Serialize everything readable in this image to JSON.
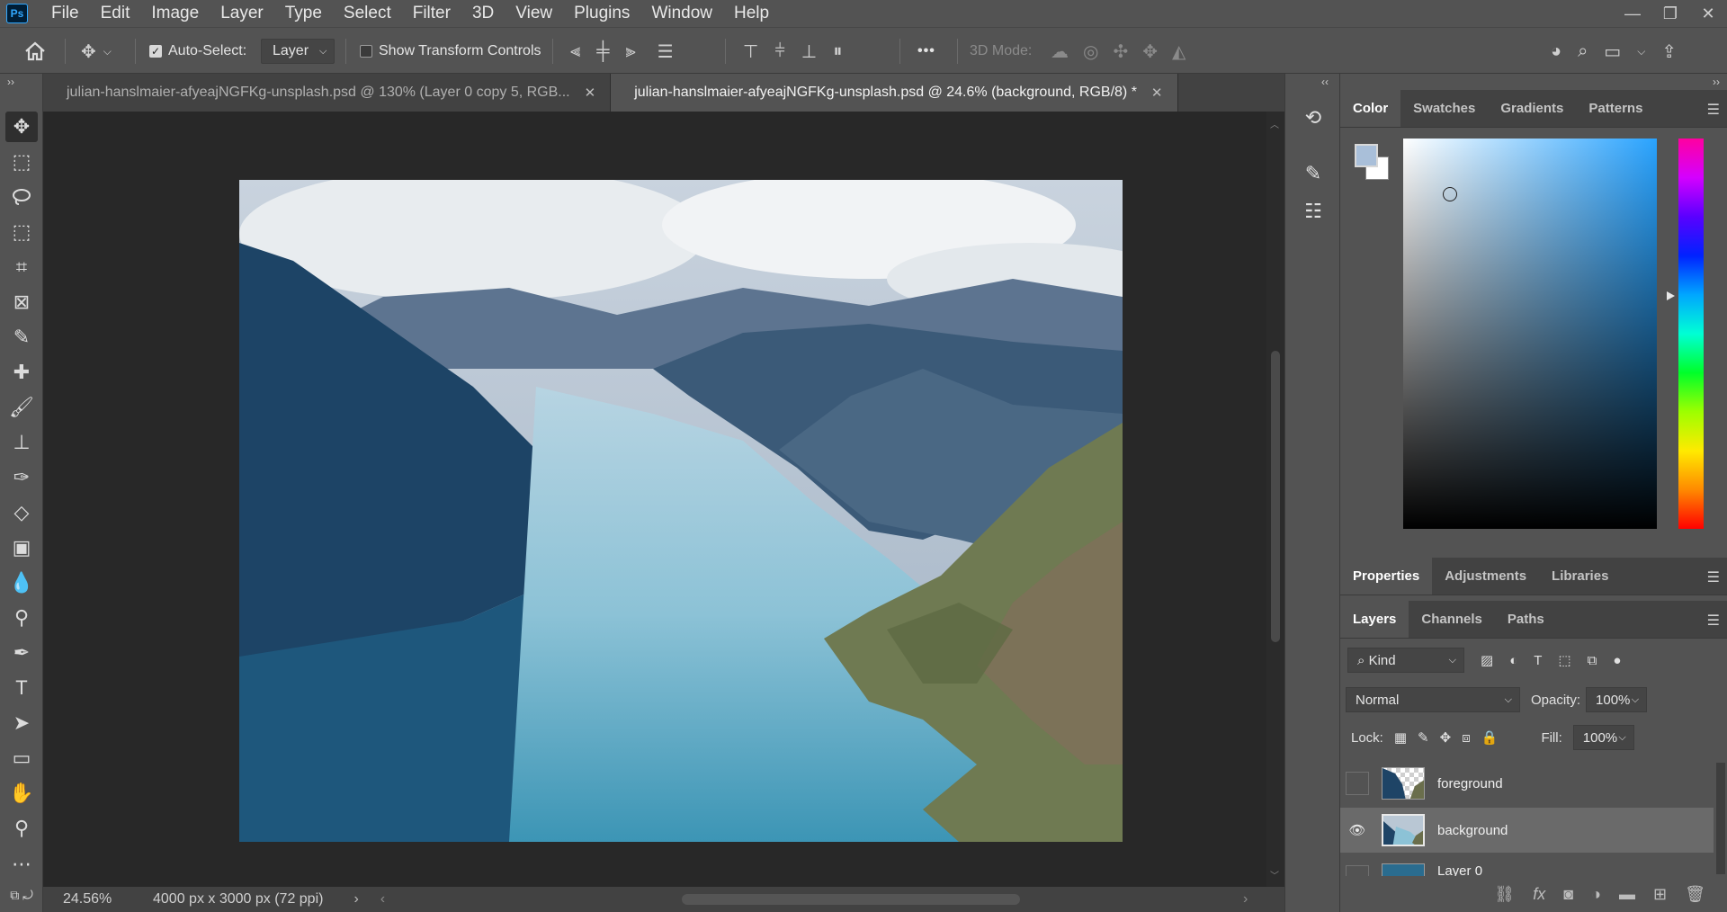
{
  "app": {
    "logo": "Ps"
  },
  "menu": [
    "File",
    "Edit",
    "Image",
    "Layer",
    "Type",
    "Select",
    "Filter",
    "3D",
    "View",
    "Plugins",
    "Window",
    "Help"
  ],
  "window_controls": {
    "minimize": "—",
    "restore": "❐",
    "close": "✕"
  },
  "options": {
    "auto_select_label": "Auto-Select:",
    "auto_select_checked": true,
    "auto_select_target": "Layer",
    "show_transform_label": "Show Transform Controls",
    "show_transform_checked": false,
    "more": "•••",
    "mode_3d_label": "3D Mode:"
  },
  "tabs": [
    {
      "title": "julian-hanslmaier-afyeajNGFKg-unsplash.psd @ 130% (Layer 0 copy 5, RGB...",
      "close": "✕"
    },
    {
      "title": "julian-hanslmaier-afyeajNGFKg-unsplash.psd @ 24.6% (background, RGB/8) *",
      "close": "✕"
    }
  ],
  "status": {
    "zoom": "24.56%",
    "doc_info": "4000 px x 3000 px (72 ppi)",
    "arrow": "›",
    "left_arrow": "‹",
    "right_arrow": "›"
  },
  "panels": {
    "collapse_left": "‹‹",
    "collapse_right": "››",
    "color_tabs": [
      "Color",
      "Swatches",
      "Gradients",
      "Patterns"
    ],
    "colors": {
      "foreground": "#a9bfd9",
      "background": "#ffffff",
      "picker_hue": "#29a3ff"
    },
    "props_tabs": [
      "Properties",
      "Adjustments",
      "Libraries"
    ],
    "layers_tabs": [
      "Layers",
      "Channels",
      "Paths"
    ],
    "kind_label": "Kind",
    "blend_mode": "Normal",
    "opacity_label": "Opacity:",
    "opacity_value": "100%",
    "lock_label": "Lock:",
    "fill_label": "Fill:",
    "fill_value": "100%"
  },
  "layers": [
    {
      "name": "foreground",
      "visible": false,
      "selected": false
    },
    {
      "name": "background",
      "visible": true,
      "selected": true
    },
    {
      "name": "Layer 0",
      "visible": false,
      "selected": false
    }
  ],
  "layer_footer_icons": [
    "link-icon",
    "fx-icon",
    "mask-icon",
    "adjustment-icon",
    "folder-icon",
    "new-layer-icon",
    "trash-icon"
  ],
  "fx_label": "fx"
}
